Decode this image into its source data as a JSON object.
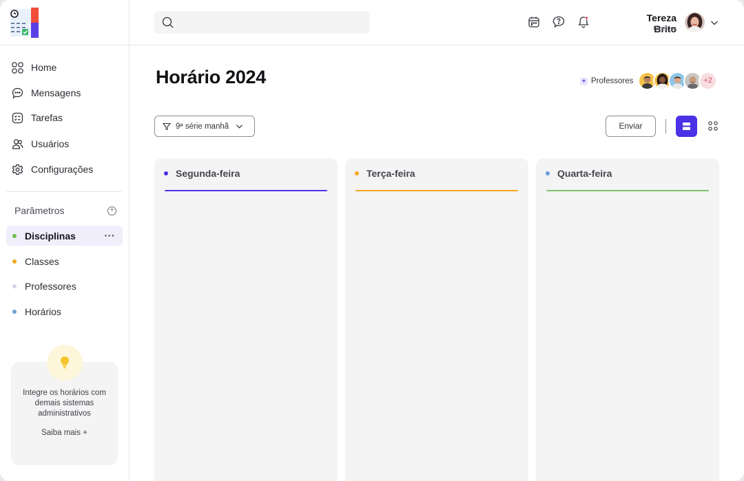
{
  "search": {
    "placeholder": ""
  },
  "sidebar": {
    "nav": [
      {
        "label": "Home",
        "icon": "grid-icon"
      },
      {
        "label": "Mensagens",
        "icon": "chat-icon"
      },
      {
        "label": "Tarefas",
        "icon": "checklist-icon"
      },
      {
        "label": "Usuários",
        "icon": "users-icon"
      },
      {
        "label": "Configurações",
        "icon": "gear-icon"
      }
    ],
    "params_title": "Parâmetros",
    "params": [
      {
        "label": "Disciplinas",
        "color": "#6cc04a",
        "active": true
      },
      {
        "label": "Classes",
        "color": "#f2a71b",
        "active": false
      },
      {
        "label": "Professores",
        "color": "#d5d2f0",
        "active": false
      },
      {
        "label": "Horários",
        "color": "#6a9fd8",
        "active": false
      }
    ],
    "more_label": "···",
    "promo": {
      "text": "Integre os horários com demais sistemas administrativos",
      "link": "Saiba mais +"
    }
  },
  "header": {
    "user_name": "Tereza Brito",
    "user_role": "Diretora"
  },
  "main": {
    "title": "Horário 2024",
    "professors_label": "Professores",
    "professors_more": "+2",
    "filter_label": "9ª série manhã",
    "send_label": "Enviar",
    "columns": [
      {
        "label": "Segunda-feira",
        "color": "#4b32e6"
      },
      {
        "label": "Terça-feira",
        "color": "#f2a71b"
      },
      {
        "label": "Quarta-feira",
        "color": "#7cc46a"
      }
    ]
  },
  "colors": {
    "accent": "#4b32e6",
    "active_bg": "#f0eefb",
    "notification": "#e0455a"
  }
}
